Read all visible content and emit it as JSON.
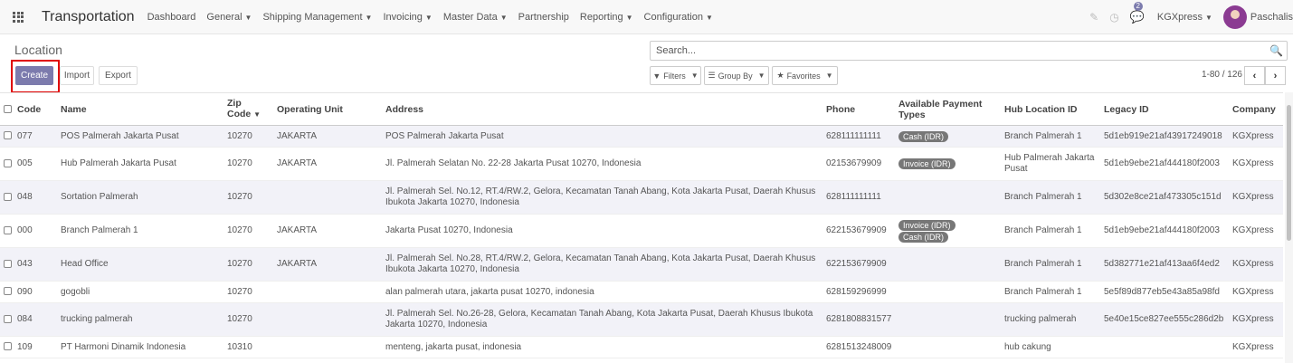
{
  "navbar": {
    "brand": "Transportation",
    "menu": [
      {
        "label": "Dashboard",
        "dropdown": false
      },
      {
        "label": "General",
        "dropdown": true
      },
      {
        "label": "Shipping Management",
        "dropdown": true
      },
      {
        "label": "Invoicing",
        "dropdown": true
      },
      {
        "label": "Master Data",
        "dropdown": true
      },
      {
        "label": "Partnership",
        "dropdown": false
      },
      {
        "label": "Reporting",
        "dropdown": true
      },
      {
        "label": "Configuration",
        "dropdown": true
      }
    ],
    "chat_count": "2",
    "company": "KGXpress",
    "user": "Paschalis"
  },
  "page": {
    "title": "Location",
    "create_label": "Create",
    "import_label": "Import",
    "export_label": "Export",
    "search_placeholder": "Search...",
    "filters_label": "Filters",
    "group_by_label": "Group By",
    "favorites_label": "Favorites",
    "pager": "1-80 / 126"
  },
  "table": {
    "headers": {
      "code": "Code",
      "name": "Name",
      "zip_line1": "Zip",
      "zip_line2": "Code",
      "operating_unit": "Operating Unit",
      "address": "Address",
      "phone": "Phone",
      "payment_line1": "Available Payment",
      "payment_line2": "Types",
      "hub": "Hub Location ID",
      "legacy": "Legacy ID",
      "company": "Company"
    },
    "rows": [
      {
        "code": "077",
        "name": "POS Palmerah Jakarta Pusat",
        "zip": "10270",
        "unit": "JAKARTA",
        "address": "POS Palmerah Jakarta Pusat",
        "phone": "628111111111",
        "payments": [
          "Cash (IDR)"
        ],
        "hub": "Branch Palmerah 1",
        "legacy": "5d1eb919e21af43917249018",
        "company": "KGXpress"
      },
      {
        "code": "005",
        "name": "Hub Palmerah Jakarta Pusat",
        "zip": "10270",
        "unit": "JAKARTA",
        "address": "Jl. Palmerah Selatan No. 22-28 Jakarta Pusat 10270, Indonesia",
        "phone": "02153679909",
        "payments": [
          "Invoice (IDR)"
        ],
        "hub": "Hub Palmerah Jakarta Pusat",
        "legacy": "5d1eb9ebe21af444180f2003",
        "company": "KGXpress"
      },
      {
        "code": "048",
        "name": "Sortation Palmerah",
        "zip": "10270",
        "unit": "",
        "address": "Jl. Palmerah Sel. No.12, RT.4/RW.2, Gelora, Kecamatan Tanah Abang, Kota Jakarta Pusat, Daerah Khusus Ibukota Jakarta 10270, Indonesia",
        "phone": "628111111111",
        "payments": [],
        "hub": "Branch Palmerah 1",
        "legacy": "5d302e8ce21af473305c151d",
        "company": "KGXpress"
      },
      {
        "code": "000",
        "name": "Branch Palmerah 1",
        "zip": "10270",
        "unit": "JAKARTA",
        "address": "Jakarta Pusat 10270, Indonesia",
        "phone": "622153679909",
        "payments": [
          "Invoice (IDR)",
          "Cash (IDR)"
        ],
        "hub": "Branch Palmerah 1",
        "legacy": "5d1eb9ebe21af444180f2003",
        "company": "KGXpress"
      },
      {
        "code": "043",
        "name": "Head Office",
        "zip": "10270",
        "unit": "JAKARTA",
        "address": "Jl. Palmerah Sel. No.28, RT.4/RW.2, Gelora, Kecamatan Tanah Abang, Kota Jakarta Pusat, Daerah Khusus Ibukota Jakarta 10270, Indonesia",
        "phone": "622153679909",
        "payments": [],
        "hub": "Branch Palmerah 1",
        "legacy": "5d382771e21af413aa6f4ed2",
        "company": "KGXpress"
      },
      {
        "code": "090",
        "name": "gogobli",
        "zip": "10270",
        "unit": "",
        "address": "alan palmerah utara, jakarta pusat 10270, indonesia",
        "phone": "628159296999",
        "payments": [],
        "hub": "Branch Palmerah 1",
        "legacy": "5e5f89d877eb5e43a85a98fd",
        "company": "KGXpress"
      },
      {
        "code": "084",
        "name": "trucking palmerah",
        "zip": "10270",
        "unit": "",
        "address": "Jl. Palmerah Sel. No.26-28, Gelora, Kecamatan Tanah Abang, Kota Jakarta Pusat, Daerah Khusus Ibukota Jakarta 10270, Indonesia",
        "phone": "6281808831577",
        "payments": [],
        "hub": "trucking palmerah",
        "legacy": "5e40e15ce827ee555c286d2b",
        "company": "KGXpress"
      },
      {
        "code": "109",
        "name": "PT Harmoni Dinamik Indonesia",
        "zip": "10310",
        "unit": "",
        "address": "menteng, jakarta pusat, indonesia",
        "phone": "6281513248009",
        "payments": [],
        "hub": "hub cakung",
        "legacy": "",
        "company": "KGXpress"
      }
    ]
  }
}
